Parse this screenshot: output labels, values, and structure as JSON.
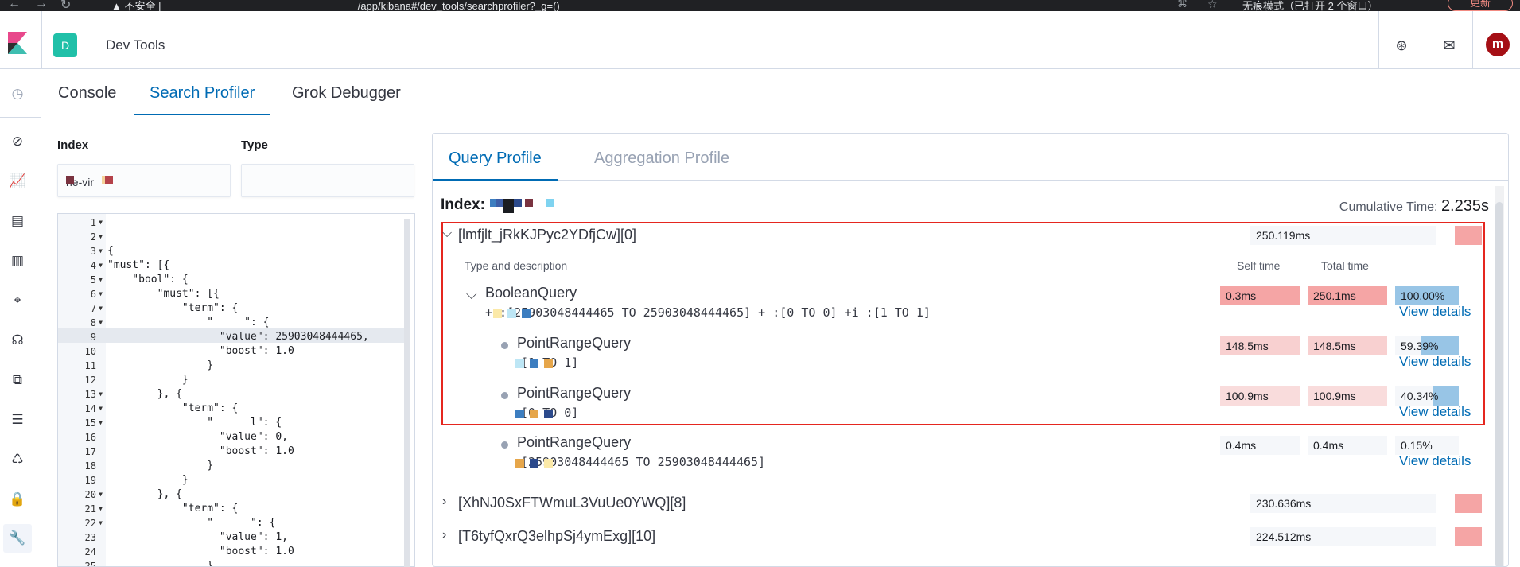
{
  "browser": {
    "nav_back": "←",
    "nav_forward": "→",
    "nav_reload": "↻",
    "url_prefix": "▲ 不安全 |",
    "url_path": "/app/kibana#/dev_tools/searchprofiler?_g=()",
    "incognito": "无痕模式（已打开 2 个窗口）",
    "update": "更新"
  },
  "header": {
    "space_badge": "D",
    "app_title": "Dev Tools",
    "avatar": "m",
    "help_icon": "help-icon",
    "mail_icon": "mail-icon"
  },
  "tabs": {
    "console": "Console",
    "search_profiler": "Search Profiler",
    "grok_debugger": "Grok Debugger"
  },
  "left": {
    "index_label": "Index",
    "type_label": "Type",
    "index_value": "he-vir"
  },
  "editor": {
    "lines": [
      {
        "n": "1",
        "fold": true,
        "text": ""
      },
      {
        "n": "2",
        "fold": true,
        "text": ""
      },
      {
        "n": "3",
        "fold": true,
        "text": "{"
      },
      {
        "n": "4",
        "fold": true,
        "text": "\"must\": [{"
      },
      {
        "n": "5",
        "fold": true,
        "text": "    \"bool\": {"
      },
      {
        "n": "6",
        "fold": true,
        "text": "        \"must\": [{"
      },
      {
        "n": "7",
        "fold": true,
        "text": "            \"term\": {"
      },
      {
        "n": "8",
        "fold": true,
        "text": "                \"     \": {"
      },
      {
        "n": "9",
        "fold": false,
        "text": "                  \"value\": 25903048444465,"
      },
      {
        "n": "10",
        "fold": false,
        "text": "                  \"boost\": 1.0"
      },
      {
        "n": "11",
        "fold": false,
        "text": "                }"
      },
      {
        "n": "12",
        "fold": false,
        "text": "            }"
      },
      {
        "n": "13",
        "fold": true,
        "text": "        }, {"
      },
      {
        "n": "14",
        "fold": true,
        "text": "            \"term\": {"
      },
      {
        "n": "15",
        "fold": true,
        "text": "                \"      l\": {"
      },
      {
        "n": "16",
        "fold": false,
        "text": "                  \"value\": 0,"
      },
      {
        "n": "17",
        "fold": false,
        "text": "                  \"boost\": 1.0"
      },
      {
        "n": "18",
        "fold": false,
        "text": "                }"
      },
      {
        "n": "19",
        "fold": false,
        "text": "            }"
      },
      {
        "n": "20",
        "fold": true,
        "text": "        }, {"
      },
      {
        "n": "21",
        "fold": true,
        "text": "            \"term\": {"
      },
      {
        "n": "22",
        "fold": true,
        "text": "                \"      \": {"
      },
      {
        "n": "23",
        "fold": false,
        "text": "                  \"value\": 1,"
      },
      {
        "n": "24",
        "fold": false,
        "text": "                  \"boost\": 1.0"
      },
      {
        "n": "25",
        "fold": false,
        "text": "                }"
      }
    ]
  },
  "profile": {
    "tab_query": "Query Profile",
    "tab_agg": "Aggregation Profile",
    "index_label": "Index:",
    "cumulative_label": "Cumulative Time:",
    "cumulative_value": "2.235s",
    "col_type": "Type and description",
    "col_self": "Self time",
    "col_total": "Total time",
    "view_details": "View details",
    "shards": [
      {
        "name": "[lmfjlt_jRkKJPyc2YDfjCw][0]",
        "time": "250.119ms",
        "expanded": true
      },
      {
        "name": "[XhNJ0SxFTWmuL3VuUe0YWQ][8]",
        "time": "230.636ms",
        "expanded": false
      },
      {
        "name": "[T6tyfQxrQ3elhpSj4ymExg][10]",
        "time": "224.512ms",
        "expanded": false
      }
    ],
    "queries": [
      {
        "name": "BooleanQuery",
        "desc": "+        :[25903048444465 TO 25903048444465] +        :[0 TO 0] +i     :[1 TO 1]",
        "self": "0.3ms",
        "total": "250.1ms",
        "pct": "100.00%",
        "pct_value": 100.0,
        "self_color": "#f5a5a5",
        "total_color": "#f5a5a5"
      },
      {
        "name": "PointRangeQuery",
        "desc": "        :[1 TO 1]",
        "self": "148.5ms",
        "total": "148.5ms",
        "pct": "59.39%",
        "pct_value": 59.39,
        "self_color": "#f8d0d0",
        "total_color": "#f8d0d0"
      },
      {
        "name": "PointRangeQuery",
        "desc": "        :[0 TO 0]",
        "self": "100.9ms",
        "total": "100.9ms",
        "pct": "40.34%",
        "pct_value": 40.34,
        "self_color": "#f9dcdc",
        "total_color": "#f9dcdc"
      },
      {
        "name": "PointRangeQuery",
        "desc": "        :[25903048444465 TO 25903048444465]",
        "self": "0.4ms",
        "total": "0.4ms",
        "pct": "0.15%",
        "pct_value": 0.15,
        "self_color": "#f5f7fa",
        "total_color": "#f5f7fa"
      }
    ]
  },
  "colors": {
    "accent": "#006bb4",
    "highlight_border": "#e5261f",
    "pct_bar": "#98c5e6"
  }
}
